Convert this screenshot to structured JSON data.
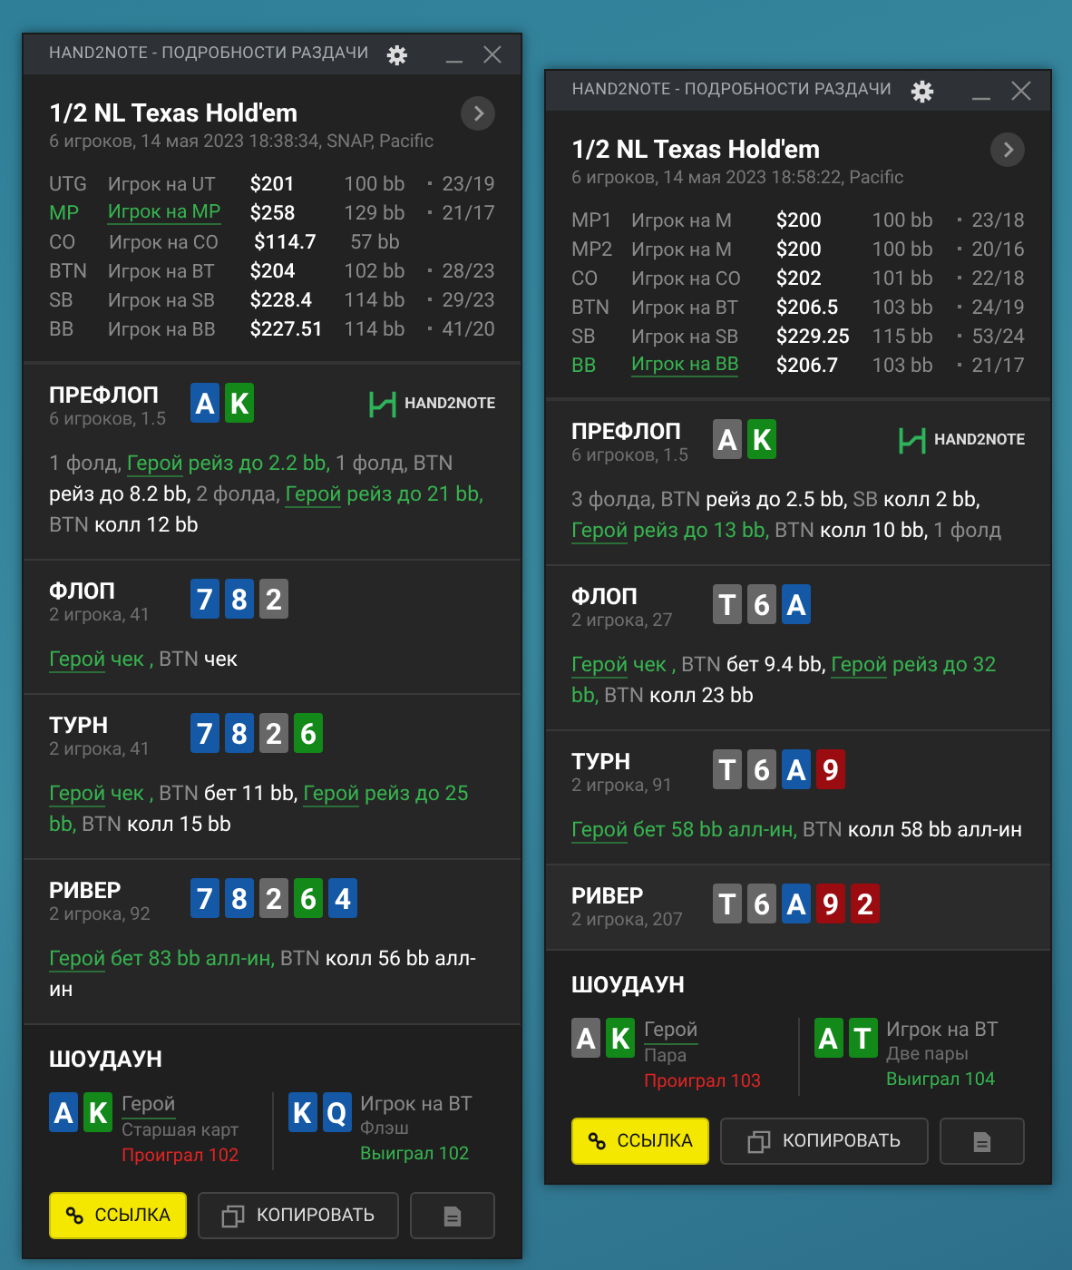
{
  "windows": [
    {
      "title": "HAND2NOTE - ПОДРОБНОСТИ РАЗДАЧИ",
      "game": "1/2 NL Texas Hold'em",
      "info": "6 игроков, 14 мая 2023 18:38:34, SNAP, Pacific",
      "players": [
        {
          "position": "UTG",
          "name": "Игрок на UT",
          "stack": "$201",
          "bb": "100 bb",
          "stats": "23/19",
          "hero": false
        },
        {
          "position": "MP",
          "name": "Игрок на MP",
          "stack": "$258",
          "bb": "129 bb",
          "stats": "21/17",
          "hero": true
        },
        {
          "position": "CO",
          "name": "Игрок на CO",
          "stack": "$114.7",
          "bb": "57 bb",
          "hero": false
        },
        {
          "position": "BTN",
          "name": "Игрок на BT",
          "stack": "$204",
          "bb": "102 bb",
          "stats": "28/23",
          "hero": false
        },
        {
          "position": "SB",
          "name": "Игрок на SB",
          "stack": "$228.4",
          "bb": "114 bb",
          "stats": "29/23",
          "hero": false
        },
        {
          "position": "BB",
          "name": "Игрок на BB",
          "stack": "$227.51",
          "bb": "114 bb",
          "stats": "41/20",
          "hero": false
        }
      ],
      "logo": "HAND2NOTE",
      "streets": [
        {
          "name": "ПРЕФЛОП",
          "sub": "6 игроков, 1.5",
          "cards": [
            {
              "rank": "A",
              "color": "#1458a6"
            },
            {
              "rank": "K",
              "color": "#13891a"
            }
          ],
          "actions": [
            {
              "kind": "fold",
              "text": "1 фолд,"
            },
            {
              "kind": "hero",
              "actor": "Герой",
              "text": "рейз до 2.2 bb,"
            },
            {
              "kind": "fold",
              "text": "1 фолд,"
            },
            {
              "kind": "villain",
              "actor": "BTN",
              "text": "рейз до 8.2 bb,"
            },
            {
              "kind": "fold",
              "text": "2 фолда,"
            },
            {
              "kind": "hero",
              "actor": "Герой",
              "text": "рейз до 21 bb,"
            },
            {
              "kind": "villain",
              "actor": "BTN",
              "text": "колл 12 bb"
            }
          ]
        },
        {
          "name": "ФЛОП",
          "sub": "2 игрока, 41",
          "cards": [
            {
              "rank": "7",
              "color": "#1458a6"
            },
            {
              "rank": "8",
              "color": "#1458a6"
            },
            {
              "rank": "2",
              "color": "#676767"
            }
          ],
          "actions": [
            {
              "kind": "hero",
              "actor": "Герой",
              "text": "чек ,"
            },
            {
              "kind": "villain",
              "actor": "BTN",
              "text": "чек"
            }
          ]
        },
        {
          "name": "ТУРН",
          "sub": "2 игрока, 41",
          "cards": [
            {
              "rank": "7",
              "color": "#1458a6"
            },
            {
              "rank": "8",
              "color": "#1458a6"
            },
            {
              "rank": "2",
              "color": "#676767"
            },
            {
              "rank": "6",
              "color": "#13891a"
            }
          ],
          "actions": [
            {
              "kind": "hero",
              "actor": "Герой",
              "text": "чек ,"
            },
            {
              "kind": "villain",
              "actor": "BTN",
              "text": "бет 11 bb,"
            },
            {
              "kind": "hero",
              "actor": "Герой",
              "text": "рейз до 25 bb,"
            },
            {
              "kind": "villain",
              "actor": "BTN",
              "text": "колл 15 bb"
            }
          ]
        },
        {
          "name": "РИВЕР",
          "sub": "2 игрока, 92",
          "cards": [
            {
              "rank": "7",
              "color": "#1458a6"
            },
            {
              "rank": "8",
              "color": "#1458a6"
            },
            {
              "rank": "2",
              "color": "#676767"
            },
            {
              "rank": "6",
              "color": "#13891a"
            },
            {
              "rank": "4",
              "color": "#1458a6"
            }
          ],
          "actions": [
            {
              "kind": "hero",
              "actor": "Герой",
              "text": "бет 83 bb алл-ин,"
            },
            {
              "kind": "villain",
              "actor": "BTN",
              "text": "колл 56 bb алл-ин"
            }
          ]
        }
      ],
      "showdown": {
        "title": "ШОУДАУН",
        "hands": [
          {
            "cards": [
              {
                "rank": "A",
                "color": "#1458a6"
              },
              {
                "rank": "K",
                "color": "#13891a"
              }
            ],
            "name": "Герой",
            "hand": "Старшая карт",
            "result": "Проиграл 102",
            "won": false,
            "hero": true
          },
          {
            "cards": [
              {
                "rank": "K",
                "color": "#1458a6"
              },
              {
                "rank": "Q",
                "color": "#1458a6"
              }
            ],
            "name": "Игрок на BT",
            "hand": "Флэш",
            "result": "Выиграл 102",
            "won": true,
            "hero": false
          }
        ]
      },
      "buttons": [
        {
          "kind": "link",
          "label": "ССЫЛКА"
        },
        {
          "kind": "copy",
          "label": "КОПИРОВАТЬ"
        },
        {
          "kind": "doc"
        }
      ]
    },
    {
      "title": "HAND2NOTE - ПОДРОБНОСТИ РАЗДАЧИ",
      "game": "1/2 NL Texas Hold'em",
      "info": "6 игроков, 14 мая 2023 18:58:22, Pacific",
      "players": [
        {
          "position": "MP1",
          "name": "Игрок на M",
          "stack": "$200",
          "bb": "100 bb",
          "stats": "23/18",
          "hero": false
        },
        {
          "position": "MP2",
          "name": "Игрок на M",
          "stack": "$200",
          "bb": "100 bb",
          "stats": "20/16",
          "hero": false
        },
        {
          "position": "CO",
          "name": "Игрок на CO",
          "stack": "$202",
          "bb": "101 bb",
          "stats": "22/18",
          "hero": false
        },
        {
          "position": "BTN",
          "name": "Игрок на BT",
          "stack": "$206.5",
          "bb": "103 bb",
          "stats": "24/19",
          "hero": false
        },
        {
          "position": "SB",
          "name": "Игрок на SB",
          "stack": "$229.25",
          "bb": "115 bb",
          "stats": "53/24",
          "hero": false
        },
        {
          "position": "BB",
          "name": "Игрок на BB",
          "stack": "$206.7",
          "bb": "103 bb",
          "stats": "21/17",
          "hero": true
        }
      ],
      "logo": "HAND2NOTE",
      "streets": [
        {
          "name": "ПРЕФЛОП",
          "sub": "6 игроков, 1.5",
          "cards": [
            {
              "rank": "A",
              "color": "#676767"
            },
            {
              "rank": "K",
              "color": "#13891a"
            }
          ],
          "actions": [
            {
              "kind": "fold",
              "text": "3 фолда,"
            },
            {
              "kind": "villain",
              "actor": "BTN",
              "text": "рейз до 2.5 bb,"
            },
            {
              "kind": "villain",
              "actor": "SB",
              "text": "колл 2 bb,"
            },
            {
              "kind": "hero",
              "actor": "Герой",
              "text": "рейз до 13 bb,"
            },
            {
              "kind": "villain",
              "actor": "BTN",
              "text": "колл 10 bb,"
            },
            {
              "kind": "fold",
              "text": "1 фолд"
            }
          ]
        },
        {
          "name": "ФЛОП",
          "sub": "2 игрока, 27",
          "cards": [
            {
              "rank": "T",
              "color": "#676767"
            },
            {
              "rank": "6",
              "color": "#676767"
            },
            {
              "rank": "A",
              "color": "#1458a6"
            }
          ],
          "actions": [
            {
              "kind": "hero",
              "actor": "Герой",
              "text": "чек ,"
            },
            {
              "kind": "villain",
              "actor": "BTN",
              "text": "бет 9.4 bb,"
            },
            {
              "kind": "hero",
              "actor": "Герой",
              "text": "рейз до 32 bb,"
            },
            {
              "kind": "villain",
              "actor": "BTN",
              "text": "колл 23 bb"
            }
          ]
        },
        {
          "name": "ТУРН",
          "sub": "2 игрока, 91",
          "cards": [
            {
              "rank": "T",
              "color": "#676767"
            },
            {
              "rank": "6",
              "color": "#676767"
            },
            {
              "rank": "A",
              "color": "#1458a6"
            },
            {
              "rank": "9",
              "color": "#9a0c10"
            }
          ],
          "actions": [
            {
              "kind": "hero",
              "actor": "Герой",
              "text": "бет 58 bb алл-ин,"
            },
            {
              "kind": "villain",
              "actor": "BTN",
              "text": "колл 58 bb алл-ин"
            }
          ]
        },
        {
          "name": "РИВЕР",
          "sub": "2 игрока, 207",
          "cards": [
            {
              "rank": "T",
              "color": "#676767"
            },
            {
              "rank": "6",
              "color": "#676767"
            },
            {
              "rank": "A",
              "color": "#1458a6"
            },
            {
              "rank": "9",
              "color": "#9a0c10"
            },
            {
              "rank": "2",
              "color": "#9a0c10"
            }
          ]
        }
      ],
      "showdown": {
        "title": "ШОУДАУН",
        "hands": [
          {
            "cards": [
              {
                "rank": "A",
                "color": "#676767"
              },
              {
                "rank": "K",
                "color": "#13891a"
              }
            ],
            "name": "Герой",
            "hand": "Пара",
            "result": "Проиграл 103",
            "won": false,
            "hero": true
          },
          {
            "cards": [
              {
                "rank": "A",
                "color": "#13891a"
              },
              {
                "rank": "T",
                "color": "#13891a"
              }
            ],
            "name": "Игрок на BT",
            "hand": "Две пары",
            "result": "Выиграл 104",
            "won": true,
            "hero": false
          }
        ]
      },
      "buttons": [
        {
          "kind": "link",
          "label": "ССЫЛКА"
        },
        {
          "kind": "copy",
          "label": "КОПИРОВАТЬ"
        },
        {
          "kind": "doc"
        }
      ]
    }
  ]
}
